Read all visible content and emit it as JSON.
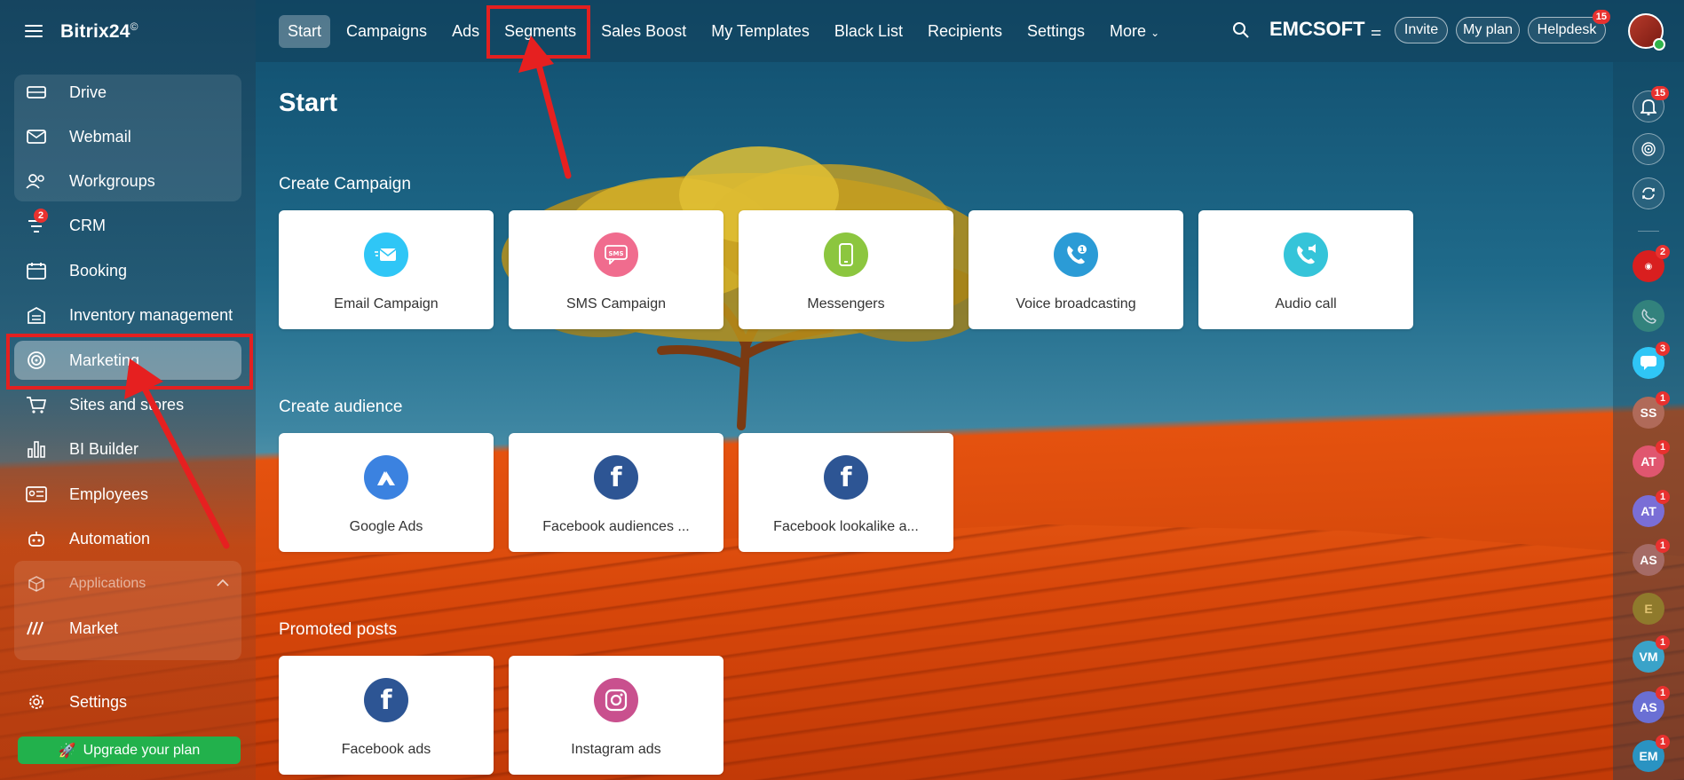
{
  "app": {
    "brand": "Bitrix24",
    "brand_mark": "©"
  },
  "sidebar": {
    "items": [
      {
        "label": "Drive",
        "icon": "drive-icon"
      },
      {
        "label": "Webmail",
        "icon": "mail-icon"
      },
      {
        "label": "Workgroups",
        "icon": "workgroups-icon"
      },
      {
        "label": "CRM",
        "icon": "crm-icon",
        "badge": "2"
      },
      {
        "label": "Booking",
        "icon": "calendar-icon"
      },
      {
        "label": "Inventory management",
        "icon": "inventory-icon"
      },
      {
        "label": "Marketing",
        "icon": "target-icon"
      },
      {
        "label": "Sites and stores",
        "icon": "cart-icon"
      },
      {
        "label": "BI Builder",
        "icon": "bar-chart-icon"
      },
      {
        "label": "Employees",
        "icon": "id-card-icon"
      },
      {
        "label": "Automation",
        "icon": "robot-icon"
      },
      {
        "label": "Applications",
        "icon": "box-icon"
      },
      {
        "label": "Market",
        "icon": "market-icon"
      }
    ],
    "settings_label": "Settings",
    "upgrade_label": "Upgrade your plan"
  },
  "topbar": {
    "tabs": [
      "Start",
      "Campaigns",
      "Ads",
      "Segments",
      "Sales Boost",
      "My Templates",
      "Black List",
      "Recipients",
      "Settings",
      "More"
    ],
    "active_tab": "Start",
    "company": "EMCSOFT",
    "invite": "Invite",
    "my_plan": "My plan",
    "helpdesk": "Helpdesk",
    "helpdesk_badge": "15"
  },
  "main": {
    "title": "Start",
    "sections": [
      {
        "title": "Create Campaign",
        "cards": [
          {
            "label": "Email Campaign",
            "icon": "email-campaign-icon",
            "color": "#2fc6f6"
          },
          {
            "label": "SMS Campaign",
            "icon": "sms-icon",
            "color": "#f06c8e"
          },
          {
            "label": "Messengers",
            "icon": "phone-icon",
            "color": "#8cc63f"
          },
          {
            "label": "Voice broadcasting",
            "icon": "voice-broadcast-icon",
            "color": "#2b9bd6"
          },
          {
            "label": "Audio call",
            "icon": "audio-call-icon",
            "color": "#35c4d9"
          }
        ]
      },
      {
        "title": "Create audience",
        "cards": [
          {
            "label": "Google Ads",
            "icon": "google-ads-icon",
            "color": "#3b82e0"
          },
          {
            "label": "Facebook audiences ...",
            "icon": "facebook-icon",
            "color": "#2d5594"
          },
          {
            "label": "Facebook lookalike a...",
            "icon": "facebook-icon",
            "color": "#2d5594"
          }
        ]
      },
      {
        "title": "Promoted posts",
        "cards": [
          {
            "label": "Facebook ads",
            "icon": "facebook-icon",
            "color": "#2d5594"
          },
          {
            "label": "Instagram ads",
            "icon": "instagram-icon",
            "color": "#c9508e"
          }
        ]
      }
    ]
  },
  "rail": {
    "notifications_badge": "15",
    "contacts": [
      {
        "initials": "",
        "badge": "2",
        "color": "#d91f1f"
      },
      {
        "initials": "",
        "badge": "",
        "color": "#3a8f7e"
      },
      {
        "initials": "",
        "badge": "3",
        "color": "#2fc6f6"
      },
      {
        "initials": "SS",
        "badge": "1",
        "color": "#b06a59"
      },
      {
        "initials": "AT",
        "badge": "1",
        "color": "#e0566f"
      },
      {
        "initials": "AT",
        "badge": "1",
        "color": "#7a6ed6"
      },
      {
        "initials": "AS",
        "badge": "1",
        "color": "#a56b66"
      },
      {
        "initials": "E",
        "badge": "",
        "color": "#8f7a2c"
      },
      {
        "initials": "VM",
        "badge": "1",
        "color": "#3aa3c9"
      },
      {
        "initials": "AS",
        "badge": "1",
        "color": "#6a6fd4"
      },
      {
        "initials": "EM",
        "badge": "1",
        "color": "#2a93c2"
      }
    ]
  }
}
